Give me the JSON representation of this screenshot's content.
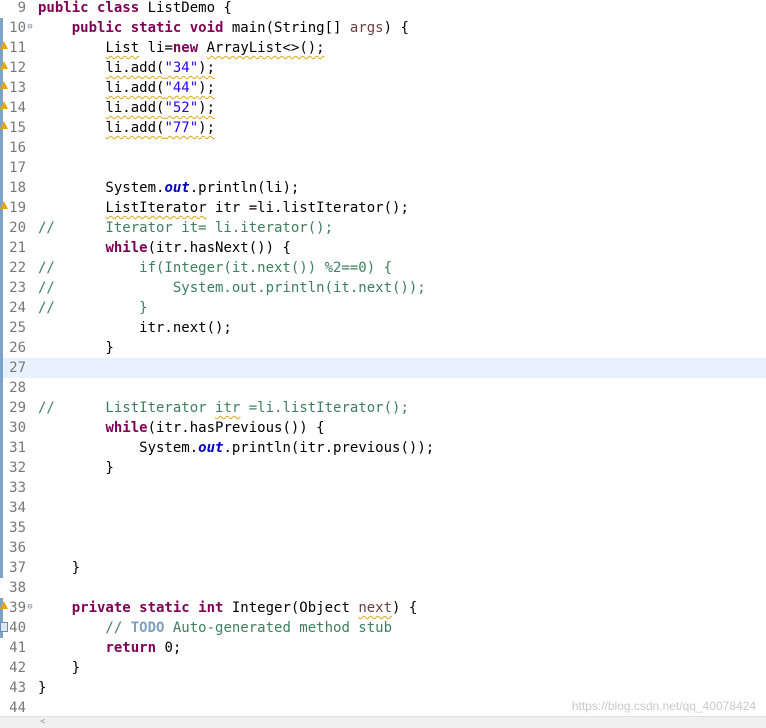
{
  "editor": {
    "lines": [
      {
        "num": "9",
        "marker": "none",
        "fold": "",
        "segments": [
          {
            "t": "public class ",
            "c": "kw"
          },
          {
            "t": "ListDemo {",
            "c": ""
          }
        ]
      },
      {
        "num": "10",
        "marker": "bar",
        "fold": "⊖",
        "segments": [
          {
            "t": "    ",
            "c": ""
          },
          {
            "t": "public static void ",
            "c": "kw"
          },
          {
            "t": "main(String[] ",
            "c": ""
          },
          {
            "t": "args",
            "c": "param"
          },
          {
            "t": ") {",
            "c": ""
          }
        ]
      },
      {
        "num": "11",
        "marker": "warn",
        "fold": "",
        "segments": [
          {
            "t": "        ",
            "c": ""
          },
          {
            "t": "List",
            "c": "sq"
          },
          {
            "t": " li=",
            "c": ""
          },
          {
            "t": "new",
            "c": "kw"
          },
          {
            "t": " ",
            "c": ""
          },
          {
            "t": "ArrayList<>();",
            "c": "sq"
          }
        ]
      },
      {
        "num": "12",
        "marker": "warn",
        "fold": "",
        "segments": [
          {
            "t": "        ",
            "c": ""
          },
          {
            "t": "li.add(",
            "c": "sq"
          },
          {
            "t": "\"34\"",
            "c": "str sq"
          },
          {
            "t": ");",
            "c": "sq"
          }
        ]
      },
      {
        "num": "13",
        "marker": "warn",
        "fold": "",
        "segments": [
          {
            "t": "        ",
            "c": ""
          },
          {
            "t": "li.add(",
            "c": "sq"
          },
          {
            "t": "\"44\"",
            "c": "str sq"
          },
          {
            "t": ");",
            "c": "sq"
          }
        ]
      },
      {
        "num": "14",
        "marker": "warn",
        "fold": "",
        "segments": [
          {
            "t": "        ",
            "c": ""
          },
          {
            "t": "li.add(",
            "c": "sq"
          },
          {
            "t": "\"52\"",
            "c": "str sq"
          },
          {
            "t": ");",
            "c": "sq"
          }
        ]
      },
      {
        "num": "15",
        "marker": "warn",
        "fold": "",
        "segments": [
          {
            "t": "        ",
            "c": ""
          },
          {
            "t": "li.add(",
            "c": "sq"
          },
          {
            "t": "\"77\"",
            "c": "str sq"
          },
          {
            "t": ");",
            "c": "sq"
          }
        ]
      },
      {
        "num": "16",
        "marker": "bar",
        "fold": "",
        "segments": []
      },
      {
        "num": "17",
        "marker": "bar",
        "fold": "",
        "segments": []
      },
      {
        "num": "18",
        "marker": "bar",
        "fold": "",
        "segments": [
          {
            "t": "        System.",
            "c": ""
          },
          {
            "t": "out",
            "c": "fld"
          },
          {
            "t": ".println(li);",
            "c": ""
          }
        ]
      },
      {
        "num": "19",
        "marker": "warn",
        "fold": "",
        "segments": [
          {
            "t": "        ",
            "c": ""
          },
          {
            "t": "ListIterator",
            "c": "sq"
          },
          {
            "t": " itr =li.listIterator();",
            "c": ""
          }
        ]
      },
      {
        "num": "20",
        "marker": "bar",
        "fold": "",
        "segments": [
          {
            "t": "//      Iterator it= li.iterator();",
            "c": "cmt"
          }
        ]
      },
      {
        "num": "21",
        "marker": "bar",
        "fold": "",
        "segments": [
          {
            "t": "        ",
            "c": ""
          },
          {
            "t": "while",
            "c": "kw"
          },
          {
            "t": "(itr.hasNext()) {",
            "c": ""
          }
        ]
      },
      {
        "num": "22",
        "marker": "bar",
        "fold": "",
        "segments": [
          {
            "t": "//          if(Integer(it.next()) %2==0) {",
            "c": "cmt"
          }
        ]
      },
      {
        "num": "23",
        "marker": "bar",
        "fold": "",
        "segments": [
          {
            "t": "//              System.out.println(it.next());",
            "c": "cmt"
          }
        ]
      },
      {
        "num": "24",
        "marker": "bar",
        "fold": "",
        "segments": [
          {
            "t": "//          }",
            "c": "cmt"
          }
        ]
      },
      {
        "num": "25",
        "marker": "bar",
        "fold": "",
        "segments": [
          {
            "t": "            itr.next();",
            "c": ""
          }
        ]
      },
      {
        "num": "26",
        "marker": "bar",
        "fold": "",
        "segments": [
          {
            "t": "        }",
            "c": ""
          }
        ]
      },
      {
        "num": "27",
        "marker": "bar",
        "fold": "",
        "current": true,
        "segments": []
      },
      {
        "num": "28",
        "marker": "bar",
        "fold": "",
        "segments": []
      },
      {
        "num": "29",
        "marker": "bar",
        "fold": "",
        "segments": [
          {
            "t": "//      ListIterator ",
            "c": "cmt"
          },
          {
            "t": "itr",
            "c": "cmt sq"
          },
          {
            "t": " =li.listIterator();",
            "c": "cmt"
          }
        ]
      },
      {
        "num": "30",
        "marker": "bar",
        "fold": "",
        "segments": [
          {
            "t": "        ",
            "c": ""
          },
          {
            "t": "while",
            "c": "kw"
          },
          {
            "t": "(itr.hasPrevious()) {",
            "c": ""
          }
        ]
      },
      {
        "num": "31",
        "marker": "bar",
        "fold": "",
        "segments": [
          {
            "t": "            System.",
            "c": ""
          },
          {
            "t": "out",
            "c": "fld"
          },
          {
            "t": ".println(itr.previous());",
            "c": ""
          }
        ]
      },
      {
        "num": "32",
        "marker": "bar",
        "fold": "",
        "segments": [
          {
            "t": "        }",
            "c": ""
          }
        ]
      },
      {
        "num": "33",
        "marker": "bar",
        "fold": "",
        "segments": []
      },
      {
        "num": "34",
        "marker": "bar",
        "fold": "",
        "segments": []
      },
      {
        "num": "35",
        "marker": "bar",
        "fold": "",
        "segments": []
      },
      {
        "num": "36",
        "marker": "bar",
        "fold": "",
        "segments": []
      },
      {
        "num": "37",
        "marker": "bar",
        "fold": "",
        "segments": [
          {
            "t": "    }",
            "c": ""
          }
        ]
      },
      {
        "num": "38",
        "marker": "none",
        "fold": "",
        "segments": []
      },
      {
        "num": "39",
        "marker": "warn",
        "fold": "⊖",
        "segments": [
          {
            "t": "    ",
            "c": ""
          },
          {
            "t": "private static int ",
            "c": "kw"
          },
          {
            "t": "Integer(Object ",
            "c": ""
          },
          {
            "t": "next",
            "c": "param sq"
          },
          {
            "t": ") {",
            "c": ""
          }
        ]
      },
      {
        "num": "40",
        "marker": "task",
        "fold": "",
        "segments": [
          {
            "t": "        // ",
            "c": "cmt"
          },
          {
            "t": "TODO",
            "c": "todo"
          },
          {
            "t": " Auto-generated method stub",
            "c": "cmt"
          }
        ]
      },
      {
        "num": "41",
        "marker": "none",
        "fold": "",
        "segments": [
          {
            "t": "        ",
            "c": ""
          },
          {
            "t": "return",
            "c": "kw"
          },
          {
            "t": " 0;",
            "c": ""
          }
        ]
      },
      {
        "num": "42",
        "marker": "none",
        "fold": "",
        "segments": [
          {
            "t": "    }",
            "c": ""
          }
        ]
      },
      {
        "num": "43",
        "marker": "none",
        "fold": "",
        "segments": [
          {
            "t": "}",
            "c": ""
          }
        ]
      },
      {
        "num": "44",
        "marker": "none",
        "fold": "",
        "segments": []
      }
    ]
  },
  "scrollbar": {
    "left_arrow": "<"
  },
  "watermark": "https://blog.csdn.net/qq_40078424",
  "colors": {
    "keyword": "#7f0055",
    "string": "#2a00ff",
    "comment": "#3f7f5f",
    "todo_tag": "#7f9fbf",
    "static_field": "#0000c0",
    "current_line": "#e8f2fe",
    "warning_marker": "#e2a616"
  }
}
